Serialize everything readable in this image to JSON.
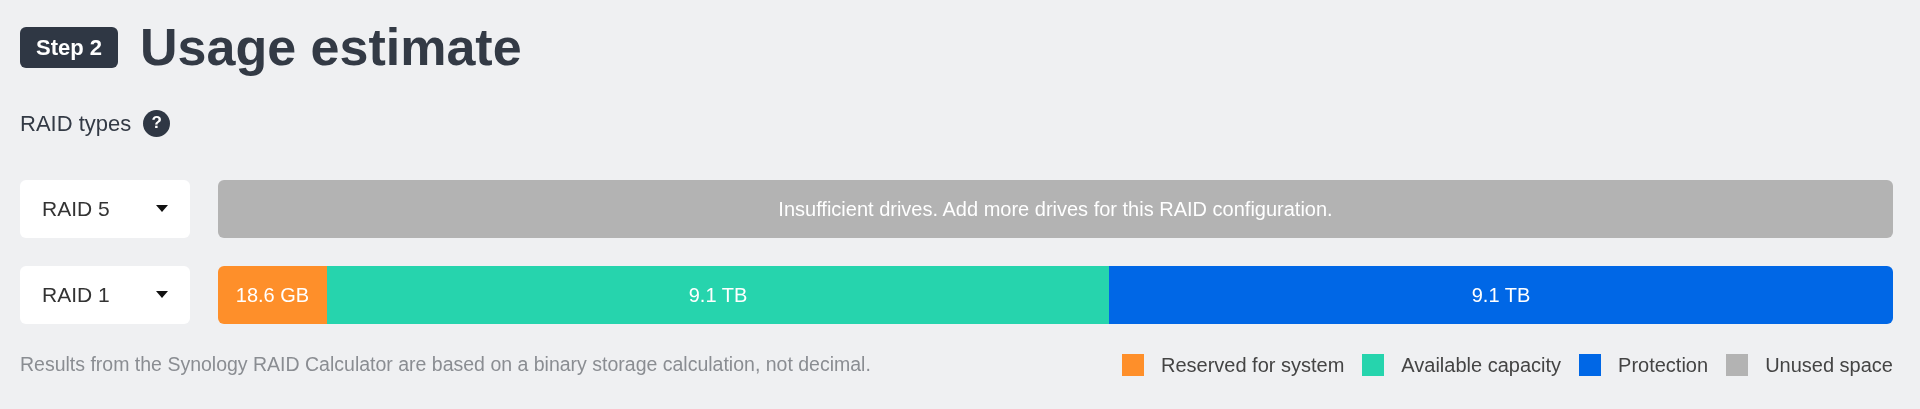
{
  "header": {
    "step_badge": "Step 2",
    "title": "Usage estimate"
  },
  "raid_types": {
    "label": "RAID types",
    "help_icon": "?"
  },
  "rows": [
    {
      "dropdown": "RAID 5",
      "kind": "message",
      "message": "Insufficient drives. Add more drives for this RAID configuration.",
      "color": "#b3b3b3"
    },
    {
      "dropdown": "RAID 1",
      "kind": "segments",
      "segments": [
        {
          "label": "18.6 GB",
          "color": "#fe8f2a"
        },
        {
          "label": "9.1 TB",
          "color": "#26d4ad"
        },
        {
          "label": "9.1 TB",
          "color": "#0067e6"
        }
      ]
    }
  ],
  "footnote": "Results from the Synology RAID Calculator are based on a binary storage calculation, not decimal.",
  "legend": [
    {
      "label": "Reserved for system",
      "color": "#fe8f2a"
    },
    {
      "label": "Available capacity",
      "color": "#26d4ad"
    },
    {
      "label": "Protection",
      "color": "#0067e6"
    },
    {
      "label": "Unused space",
      "color": "#b3b3b3"
    }
  ]
}
